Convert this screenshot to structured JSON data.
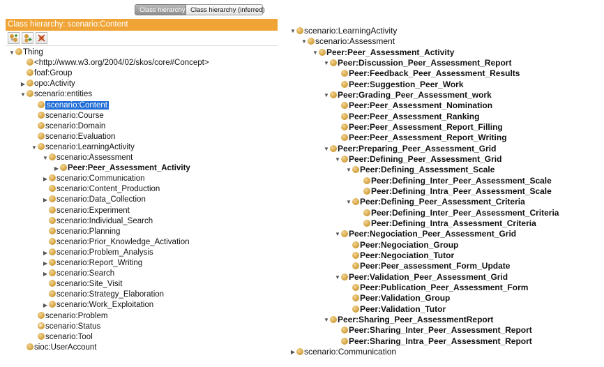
{
  "tabs": {
    "active": "Class hierarchy",
    "inactive": "Class hierarchy (inferred)"
  },
  "header": {
    "title": "Class hierarchy: scenario:Content"
  },
  "toolbar": {
    "icons": [
      "add-subclass-icon",
      "add-sibling-icon",
      "delete-class-icon"
    ]
  },
  "left_tree": [
    {
      "label": "Thing",
      "depth": 0,
      "expander": "open"
    },
    {
      "label": "<http://www.w3.org/2004/02/skos/core#Concept>",
      "depth": 1,
      "expander": "none"
    },
    {
      "label": "foaf:Group",
      "depth": 1,
      "expander": "none"
    },
    {
      "label": "opo:Activity",
      "depth": 1,
      "expander": "closed"
    },
    {
      "label": "scenario:entities",
      "depth": 1,
      "expander": "open"
    },
    {
      "label": "scenario:Content",
      "depth": 2,
      "expander": "none",
      "selected": true
    },
    {
      "label": "scenario:Course",
      "depth": 2,
      "expander": "none"
    },
    {
      "label": "scenario:Domain",
      "depth": 2,
      "expander": "none"
    },
    {
      "label": "scenario:Evaluation",
      "depth": 2,
      "expander": "none"
    },
    {
      "label": "scenario:LearningActivity",
      "depth": 2,
      "expander": "open"
    },
    {
      "label": "scenario:Assessment",
      "depth": 3,
      "expander": "open"
    },
    {
      "label": "Peer:Peer_Assessment_Activity",
      "depth": 4,
      "expander": "closed",
      "bold": true
    },
    {
      "label": "scenario:Communication",
      "depth": 3,
      "expander": "closed"
    },
    {
      "label": "scenario:Content_Production",
      "depth": 3,
      "expander": "none"
    },
    {
      "label": "scenario:Data_Collection",
      "depth": 3,
      "expander": "closed"
    },
    {
      "label": "scenario:Experiment",
      "depth": 3,
      "expander": "none"
    },
    {
      "label": "scenario:Individual_Search",
      "depth": 3,
      "expander": "none"
    },
    {
      "label": "scenario:Planning",
      "depth": 3,
      "expander": "none"
    },
    {
      "label": "scenario:Prior_Knowledge_Activation",
      "depth": 3,
      "expander": "none"
    },
    {
      "label": "scenario:Problem_Analysis",
      "depth": 3,
      "expander": "closed"
    },
    {
      "label": "scenario:Report_Writing",
      "depth": 3,
      "expander": "closed"
    },
    {
      "label": "scenario:Search",
      "depth": 3,
      "expander": "closed"
    },
    {
      "label": "scenario:Site_Visit",
      "depth": 3,
      "expander": "none"
    },
    {
      "label": "scenario:Strategy_Elaboration",
      "depth": 3,
      "expander": "none"
    },
    {
      "label": "scenario:Work_Exploitation",
      "depth": 3,
      "expander": "closed"
    },
    {
      "label": "scenario:Problem",
      "depth": 2,
      "expander": "none"
    },
    {
      "label": "scenario:Status",
      "depth": 2,
      "expander": "none",
      "equivalent": true
    },
    {
      "label": "scenario:Tool",
      "depth": 2,
      "expander": "none"
    },
    {
      "label": "sioc:UserAccount",
      "depth": 1,
      "expander": "none"
    }
  ],
  "right_tree": [
    {
      "label": "scenario:LearningActivity",
      "depth": 0,
      "expander": "open"
    },
    {
      "label": "scenario:Assessment",
      "depth": 1,
      "expander": "open"
    },
    {
      "label": "Peer:Peer_Assessment_Activity",
      "depth": 2,
      "expander": "open",
      "bold": true
    },
    {
      "label": "Peer:Discussion_Peer_Assessment_Report",
      "depth": 3,
      "expander": "open",
      "bold": true
    },
    {
      "label": "Peer:Feedback_Peer_Assessment_Results",
      "depth": 4,
      "expander": "none",
      "bold": true
    },
    {
      "label": "Peer:Suggestion_Peer_Work",
      "depth": 4,
      "expander": "none",
      "bold": true
    },
    {
      "label": "Peer:Grading_Peer_Assessment_work",
      "depth": 3,
      "expander": "open",
      "bold": true
    },
    {
      "label": "Peer:Peer_Assessment_Nomination",
      "depth": 4,
      "expander": "none",
      "bold": true
    },
    {
      "label": "Peer:Peer_Assessment_Ranking",
      "depth": 4,
      "expander": "none",
      "bold": true
    },
    {
      "label": "Peer:Peer_Assessment_Report_Filling",
      "depth": 4,
      "expander": "none",
      "bold": true
    },
    {
      "label": "Peer:Peer_Assessment_Report_Writing",
      "depth": 4,
      "expander": "none",
      "bold": true
    },
    {
      "label": "Peer:Preparing_Peer_Assessment_Grid",
      "depth": 3,
      "expander": "open",
      "bold": true
    },
    {
      "label": "Peer:Defining_Peer_Assessment_Grid",
      "depth": 4,
      "expander": "open",
      "bold": true
    },
    {
      "label": "Peer:Defining_Assessment_Scale",
      "depth": 5,
      "expander": "open",
      "bold": true
    },
    {
      "label": "Peer:Defining_Inter_Peer_Assessment_Scale",
      "depth": 6,
      "expander": "none",
      "bold": true
    },
    {
      "label": "Peer:Defining_Intra_Peer_Assessment_Scale",
      "depth": 6,
      "expander": "none",
      "bold": true
    },
    {
      "label": "Peer:Defining_Peer_Assessment_Criteria",
      "depth": 5,
      "expander": "open",
      "bold": true
    },
    {
      "label": "Peer:Defining_Inter_Peer_Assessment_Criteria",
      "depth": 6,
      "expander": "none",
      "bold": true
    },
    {
      "label": "Peer:Defining_Intra_Assessment_Criteria",
      "depth": 6,
      "expander": "none",
      "bold": true
    },
    {
      "label": "Peer:Negociation_Peer_Assessment_Grid",
      "depth": 4,
      "expander": "open",
      "bold": true
    },
    {
      "label": "Peer:Negociation_Group",
      "depth": 5,
      "expander": "none",
      "bold": true
    },
    {
      "label": "Peer:Negociation_Tutor",
      "depth": 5,
      "expander": "none",
      "bold": true
    },
    {
      "label": "Peer:Peer_assessment_Form_Update",
      "depth": 5,
      "expander": "none",
      "bold": true
    },
    {
      "label": "Peer:Validation_Peer_Assessment_Grid",
      "depth": 4,
      "expander": "open",
      "bold": true
    },
    {
      "label": "Peer:Publication_Peer_Assessment_Form",
      "depth": 5,
      "expander": "none",
      "bold": true
    },
    {
      "label": "Peer:Validation_Group",
      "depth": 5,
      "expander": "none",
      "bold": true
    },
    {
      "label": "Peer:Validation_Tutor",
      "depth": 5,
      "expander": "none",
      "bold": true
    },
    {
      "label": "Peer:Sharing_Peer_AssessmentReport",
      "depth": 3,
      "expander": "open",
      "bold": true
    },
    {
      "label": "Peer:Sharing_Inter_Peer_Assessment_Report",
      "depth": 4,
      "expander": "none",
      "bold": true
    },
    {
      "label": "Peer:Sharing_Intra_Peer_Assessment_Report",
      "depth": 4,
      "expander": "none",
      "bold": true
    },
    {
      "label": "scenario:Communication",
      "depth": 0,
      "expander": "closed"
    }
  ]
}
